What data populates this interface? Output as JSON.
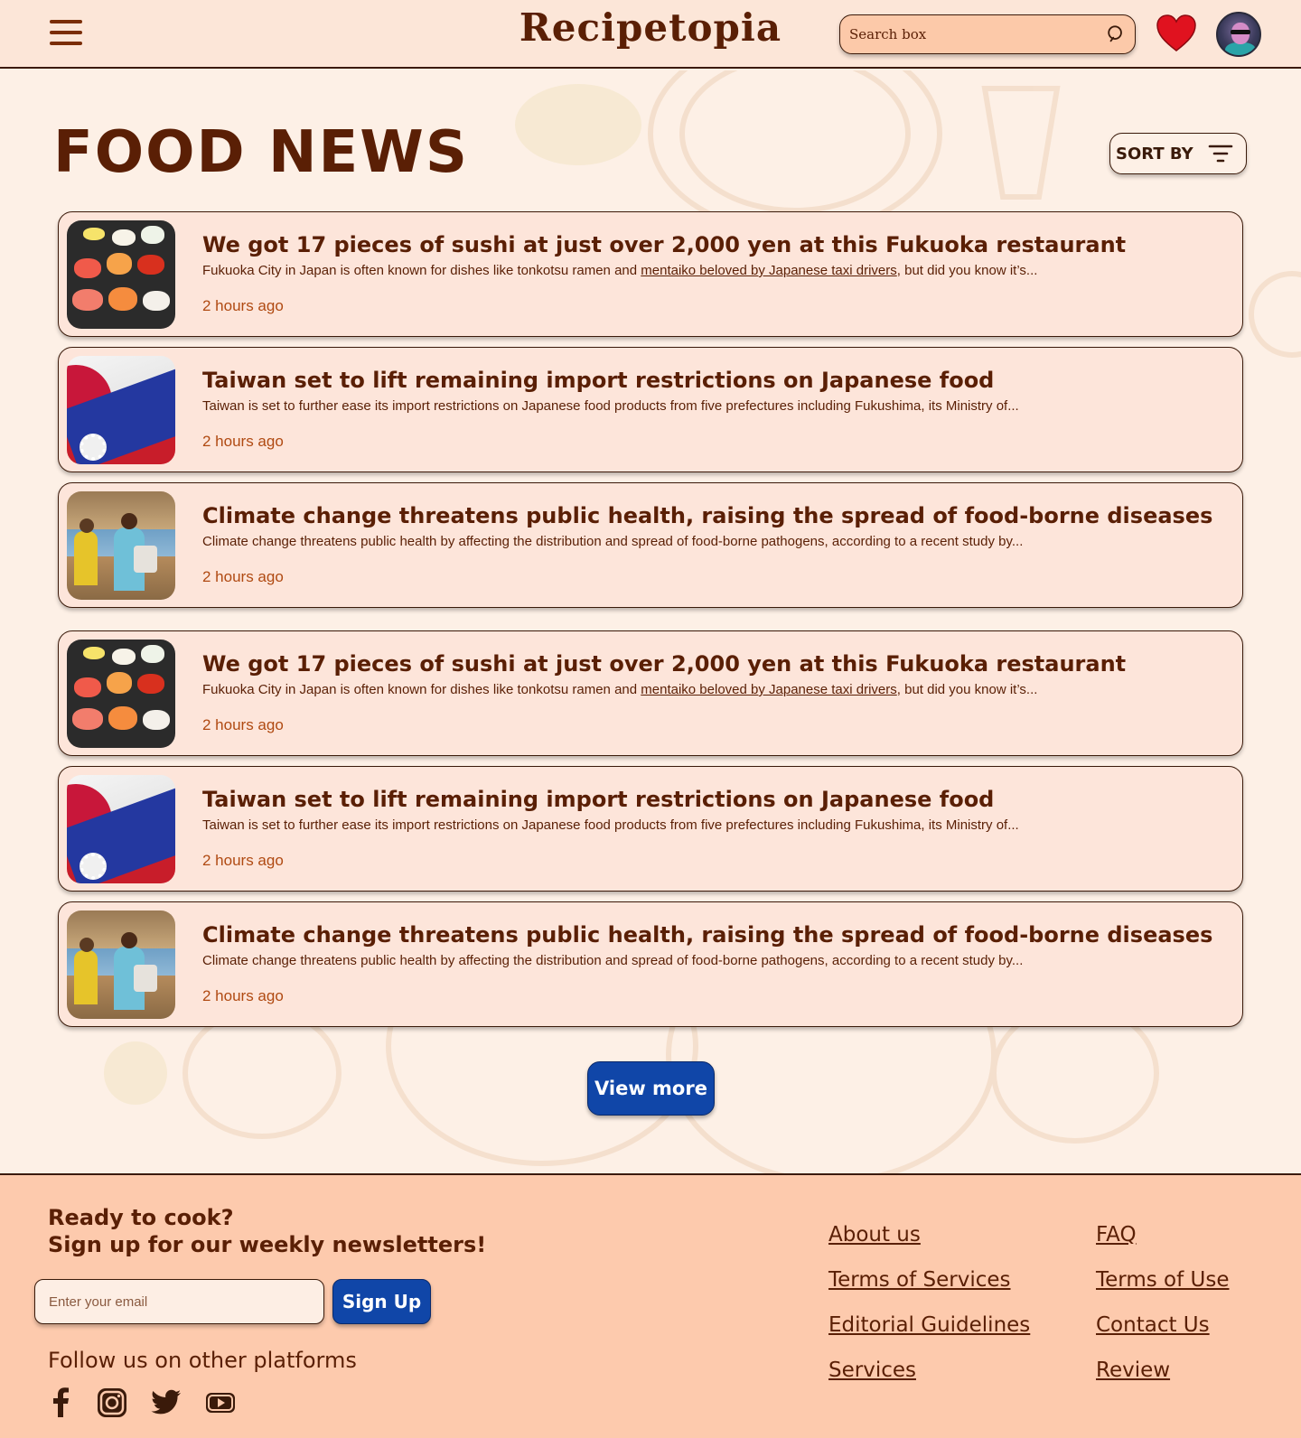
{
  "header": {
    "brand": "Recipetopia",
    "search_placeholder": "Search box"
  },
  "main": {
    "title": "FOOD NEWS",
    "sort_label": "SORT BY",
    "view_more_label": "View more",
    "articles": [
      {
        "title": "We got 17 pieces of sushi at just over 2,000 yen at this Fukuoka restaurant",
        "desc_before": "Fukuoka City in Japan is often known for dishes like tonkotsu ramen and ",
        "desc_link": "mentaiko beloved by Japanese taxi drivers",
        "desc_after": ", but did you know it’s...",
        "time": "2 hours ago",
        "image": "sushi-platter"
      },
      {
        "title": "Taiwan set to lift remaining import restrictions on Japanese food",
        "desc_before": "Taiwan is set to further ease its import restrictions on Japanese food products from five prefectures including Fukushima, its Ministry of...",
        "desc_link": "",
        "desc_after": "",
        "time": "2 hours ago",
        "image": "japan-taiwan-flags"
      },
      {
        "title": "Climate change threatens public health, raising the spread of food-borne diseases",
        "desc_before": "Climate change threatens public health by affecting the distribution and spread of food-borne pathogens, according to a recent study by...",
        "desc_link": "",
        "desc_after": "",
        "time": "2 hours ago",
        "image": "market-vendors"
      },
      {
        "title": "We got 17 pieces of sushi at just over 2,000 yen at this Fukuoka restaurant",
        "desc_before": "Fukuoka City in Japan is often known for dishes like tonkotsu ramen and ",
        "desc_link": "mentaiko beloved by Japanese taxi drivers",
        "desc_after": ", but did you know it’s...",
        "time": "2 hours ago",
        "image": "sushi-platter"
      },
      {
        "title": "Taiwan set to lift remaining import restrictions on Japanese food",
        "desc_before": "Taiwan is set to further ease its import restrictions on Japanese food products from five prefectures including Fukushima, its Ministry of...",
        "desc_link": "",
        "desc_after": "",
        "time": "2 hours ago",
        "image": "japan-taiwan-flags"
      },
      {
        "title": "Climate change threatens public health, raising the spread of food-borne diseases",
        "desc_before": "Climate change threatens public health by affecting the distribution and spread of food-borne pathogens, according to a recent study by...",
        "desc_link": "",
        "desc_after": "",
        "time": "2 hours ago",
        "image": "market-vendors"
      }
    ]
  },
  "footer": {
    "heading_line1": "Ready to cook?",
    "heading_line2": "Sign up for our weekly newsletters!",
    "email_placeholder": "Enter your email",
    "signup_label": "Sign Up",
    "follow_label": "Follow us on other platforms",
    "social_icons": [
      "facebook-icon",
      "instagram-icon",
      "twitter-icon",
      "youtube-icon"
    ],
    "links_col1": [
      "About us",
      "Terms of Services",
      "Editorial Guidelines",
      "Services"
    ],
    "links_col2": [
      "FAQ",
      "Terms of Use",
      "Contact Us",
      "Review"
    ]
  },
  "colors": {
    "header_bg": "#fce6d8",
    "page_bg": "#fdf0e6",
    "card_bg": "#fde5da",
    "footer_bg": "#fdcaad",
    "text_primary": "#5a1f05",
    "time_text": "#b04a12",
    "accent_button": "#1046a8",
    "heart": "#e0121f"
  }
}
